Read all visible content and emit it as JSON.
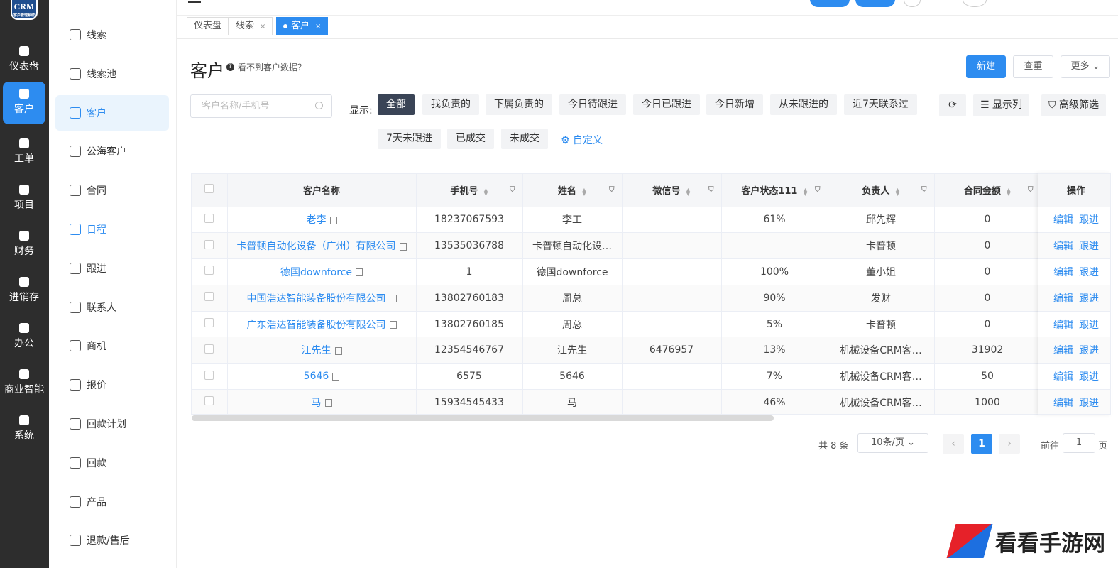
{
  "app": {
    "logo_text": "CRM",
    "logo_sub": "客户管理系统"
  },
  "rail": [
    {
      "label": "仪表盘",
      "icon": "home-icon"
    },
    {
      "label": "客户",
      "icon": "user-icon",
      "active": true
    },
    {
      "label": "工单",
      "icon": "clipboard-icon"
    },
    {
      "label": "项目",
      "icon": "books-icon"
    },
    {
      "label": "财务",
      "icon": "yen-icon"
    },
    {
      "label": "进销存",
      "icon": "house-icon"
    },
    {
      "label": "办公",
      "icon": "document-icon"
    },
    {
      "label": "商业智能",
      "icon": "chart-icon"
    },
    {
      "label": "系统",
      "icon": "system-icon"
    }
  ],
  "submenu": [
    {
      "label": "线索",
      "icon": "person-icon"
    },
    {
      "label": "线索池",
      "icon": "list-icon"
    },
    {
      "label": "客户",
      "icon": "people-icon",
      "active": true
    },
    {
      "label": "公海客户",
      "icon": "group-icon"
    },
    {
      "label": "合同",
      "icon": "contract-icon"
    },
    {
      "label": "日程",
      "icon": "schedule-icon",
      "blue": true
    },
    {
      "label": "跟进",
      "icon": "followup-icon"
    },
    {
      "label": "联系人",
      "icon": "contact-icon"
    },
    {
      "label": "商机",
      "icon": "opportunity-icon"
    },
    {
      "label": "报价",
      "icon": "quote-icon"
    },
    {
      "label": "回款计划",
      "icon": "payment-plan-icon"
    },
    {
      "label": "回款",
      "icon": "payment-icon"
    },
    {
      "label": "产品",
      "icon": "product-icon"
    },
    {
      "label": "退款/售后",
      "icon": "refund-icon"
    }
  ],
  "tabs": [
    {
      "label": "仪表盘",
      "closable": false
    },
    {
      "label": "线索",
      "closable": true
    },
    {
      "label": "客户",
      "closable": true,
      "active": true
    }
  ],
  "page": {
    "title": "客户",
    "hint": "看不到客户数据？",
    "new_label": "新建",
    "check_label": "查重",
    "more_label": "更多"
  },
  "search": {
    "placeholder": "客户名称/手机号"
  },
  "filters": {
    "show_label": "显示:",
    "chips": [
      "全部",
      "我负责的",
      "下属负责的",
      "今日待跟进",
      "今日已跟进",
      "今日新增",
      "从未跟进的",
      "近7天联系过",
      "7天未跟进",
      "已成交",
      "未成交"
    ],
    "custom_label": "自定义"
  },
  "tools": {
    "columns_label": "显示列",
    "advanced_label": "高级筛选"
  },
  "table": {
    "headers": [
      "客户名称",
      "手机号",
      "姓名",
      "微信号",
      "客户状态111",
      "负责人",
      "合同金额",
      "操作"
    ],
    "rows": [
      {
        "name": "老李",
        "phone": "18237067593",
        "contact": "李工",
        "wechat": "",
        "status": "61%",
        "owner": "邱先辉",
        "amount": "0"
      },
      {
        "name": "卡普顿自动化设备（广州）有限公司",
        "phone": "13535036788",
        "contact": "卡普顿自动化设…",
        "wechat": "",
        "status": "",
        "owner": "卡普顿",
        "amount": "0"
      },
      {
        "name": "德国downforce",
        "phone": "1",
        "contact": "德国downforce",
        "wechat": "",
        "status": "100%",
        "owner": "董小姐",
        "amount": "0"
      },
      {
        "name": "中国浩达智能装备股份有限公司",
        "phone": "13802760183",
        "contact": "周总",
        "wechat": "",
        "status": "90%",
        "owner": "发财",
        "amount": "0"
      },
      {
        "name": "广东浩达智能装备股份有限公司",
        "phone": "13802760185",
        "contact": "周总",
        "wechat": "",
        "status": "5%",
        "owner": "卡普顿",
        "amount": "0"
      },
      {
        "name": "江先生",
        "phone": "12354546767",
        "contact": "江先生",
        "wechat": "6476957",
        "status": "13%",
        "owner": "机械设备CRM客…",
        "amount": "31902"
      },
      {
        "name": "5646",
        "phone": "6575",
        "contact": "5646",
        "wechat": "",
        "status": "7%",
        "owner": "机械设备CRM客…",
        "amount": "50"
      },
      {
        "name": "马",
        "phone": "15934545433",
        "contact": "马",
        "wechat": "",
        "status": "46%",
        "owner": "机械设备CRM客…",
        "amount": "1000"
      }
    ],
    "edit_label": "编辑",
    "follow_label": "跟进"
  },
  "pagination": {
    "total": "共 8 条",
    "page_size": "10条/页",
    "current": "1",
    "goto_prefix": "前往",
    "goto_value": "1",
    "goto_suffix": "页"
  },
  "watermark": "看看手游网"
}
